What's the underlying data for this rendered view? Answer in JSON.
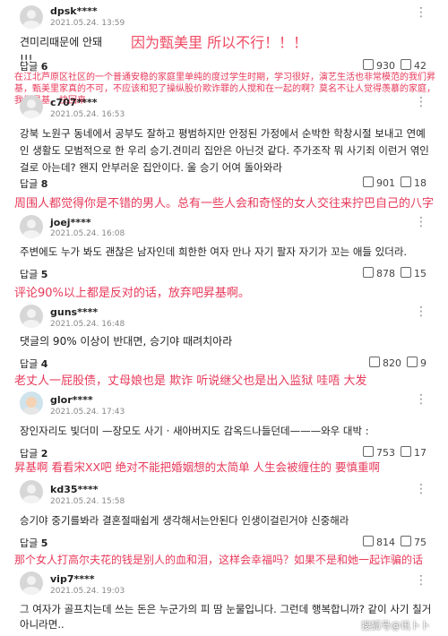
{
  "comments": [
    {
      "user": "dpsk****",
      "date": "2021.05.24. 13:59",
      "text": "견미리때문에 안돼 !!!",
      "replies_label": "답글",
      "replies": "6",
      "up": "930",
      "down": "42"
    },
    {
      "user": "c707****",
      "date": "2021.05.24. 16:53",
      "text": "강북 노원구 동네에서 공부도 잘하고 평범하지만 안정된 가정에서 순박한 학창시절 보내고 연예인 생활도 모범적으로 한 우리 승기.견미리 집안은 아닌것 같다. 주가조작 뭐 사기죄 이런거 엮인걸로 아는데? 왠지 안부러운 집안이다. 울 승기 어여 돌아와라",
      "replies_label": "답글",
      "replies": "8",
      "up": "901",
      "down": "18"
    },
    {
      "user": "joej****",
      "date": "2021.05.24. 16:08",
      "text": "주변에도 누가 봐도 괜찮은 남자인데 희한한 여자 만나 자기 팔자 자기가 꼬는 애들 있더라.",
      "replies_label": "답글",
      "replies": "5",
      "up": "878",
      "down": "15"
    },
    {
      "user": "guns****",
      "date": "2021.05.24. 16:48",
      "text": "댓글의 90% 이상이 반대면, 승기야 때려치아라",
      "replies_label": "답글",
      "replies": "4",
      "up": "820",
      "down": "9"
    },
    {
      "user": "glor****",
      "date": "2021.05.24. 17:43",
      "text": "장인자리도 빛더미 —장모도 사기 · 새아버지도 감옥드나들던데———와우 대박 :",
      "replies_label": "답글",
      "replies": "2",
      "up": "753",
      "down": "17"
    },
    {
      "user": "kd35****",
      "date": "2021.05.24. 15:58",
      "text": "승기야 중기를봐라 결혼절때쉽게 생각해서는안된다 인생이걸린거야 신중해라",
      "replies_label": "답글",
      "replies": "5",
      "up": "814",
      "down": "75"
    },
    {
      "user": "vip7****",
      "date": "2021.05.24. 19:03",
      "text": "그 여자가 골프치는데 쓰는 돈은 누군가의 피 땀 눈물입니다. 그런데 행복합니까? 같이 사기 칠거 아니라면..",
      "replies_label": "",
      "replies": "",
      "up": "",
      "down": ""
    }
  ],
  "annotations": {
    "a1": "因为甄美里 所以不行！！！",
    "a2": "在江北芦原区社区的一个普通安稳的家庭里单纯的度过学生时期，学习很好，演艺生活也非常模范的我们昇基，甄美里家真的不可，不应该和犯了操纵股价欺诈罪的人搅和在一起的啊？莫名不让人觉得羡慕的家庭，我们昇基，快回来",
    "a3": "周围人都觉得你是不错的男人。总有一些人会和奇怪的女人交往来拧巴自己的八字",
    "a4": "评论90%以上都是反对的话，放弃吧昇基啊。",
    "a5": "老丈人一屁股债，丈母娘也是 欺诈 听说继父也是出入监狱 哇唔 大发",
    "a6": "昇基啊 看看宋XX吧 绝对不能把婚姻想的太简单 人生会被缠住的 要慎重啊",
    "a7": "那个女人打高尔夫花的钱是别人的血和泪，这样会幸福吗？如果不是和她一起诈骗的话"
  },
  "watermark": "搜狐号@讯卜卜"
}
